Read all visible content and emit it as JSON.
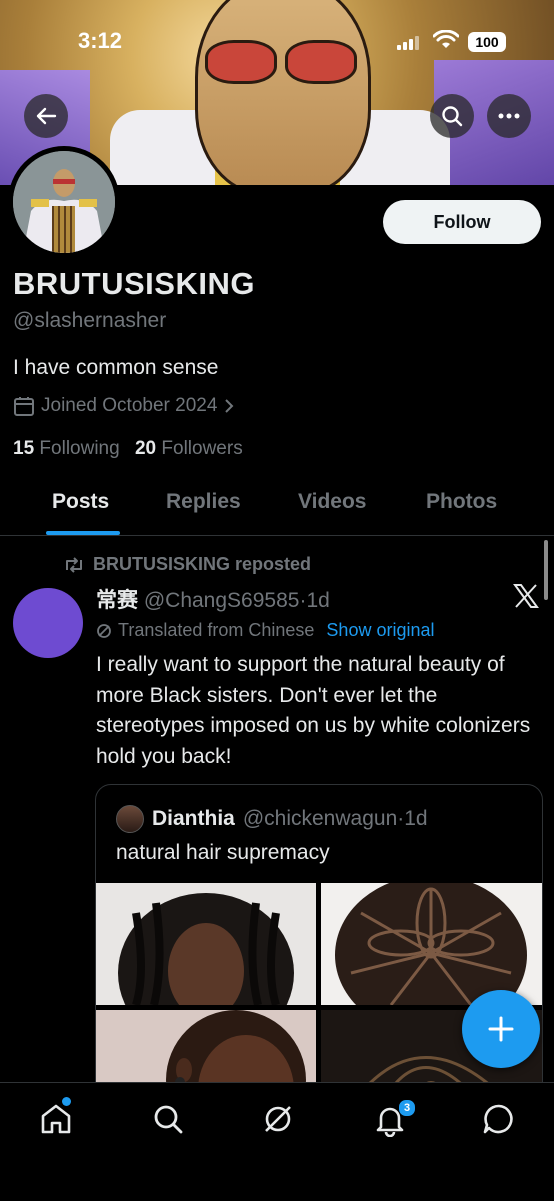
{
  "status_bar": {
    "time": "3:12",
    "battery": "100"
  },
  "profile": {
    "follow_label": "Follow",
    "display_name": "BRUTUSISKING",
    "handle": "@slashernasher",
    "bio": "I have common sense",
    "joined": "Joined October 2024",
    "following_count": "15",
    "following_label": "Following",
    "followers_count": "20",
    "followers_label": "Followers"
  },
  "tabs": [
    {
      "label": "Posts",
      "active": true
    },
    {
      "label": "Replies",
      "active": false
    },
    {
      "label": "Videos",
      "active": false
    },
    {
      "label": "Photos",
      "active": false
    }
  ],
  "post": {
    "repost_label": "BRUTUSISKING reposted",
    "display_name": "常赛",
    "handle": "@ChangS69585",
    "separator": "·",
    "time": "1d",
    "translated_label": "Translated from Chinese",
    "show_original_label": "Show original",
    "text": "I really want to support the natural beauty of more Black sisters. Don't ever let the stereotypes imposed on us by white colonizers hold you back!",
    "quote": {
      "display_name": "Dianthia",
      "handle": "@chickenwagun",
      "separator": "·",
      "time": "1d",
      "text": "natural hair supremacy"
    }
  },
  "nav": {
    "items": [
      "home-icon",
      "search-icon",
      "grok-icon",
      "notifications-icon",
      "messages-icon"
    ],
    "notification_count": "3"
  },
  "colors": {
    "accent": "#1d9bf0",
    "background": "#000000",
    "secondary_text": "#71767b",
    "avatar_purple": "#6e4bd1"
  }
}
